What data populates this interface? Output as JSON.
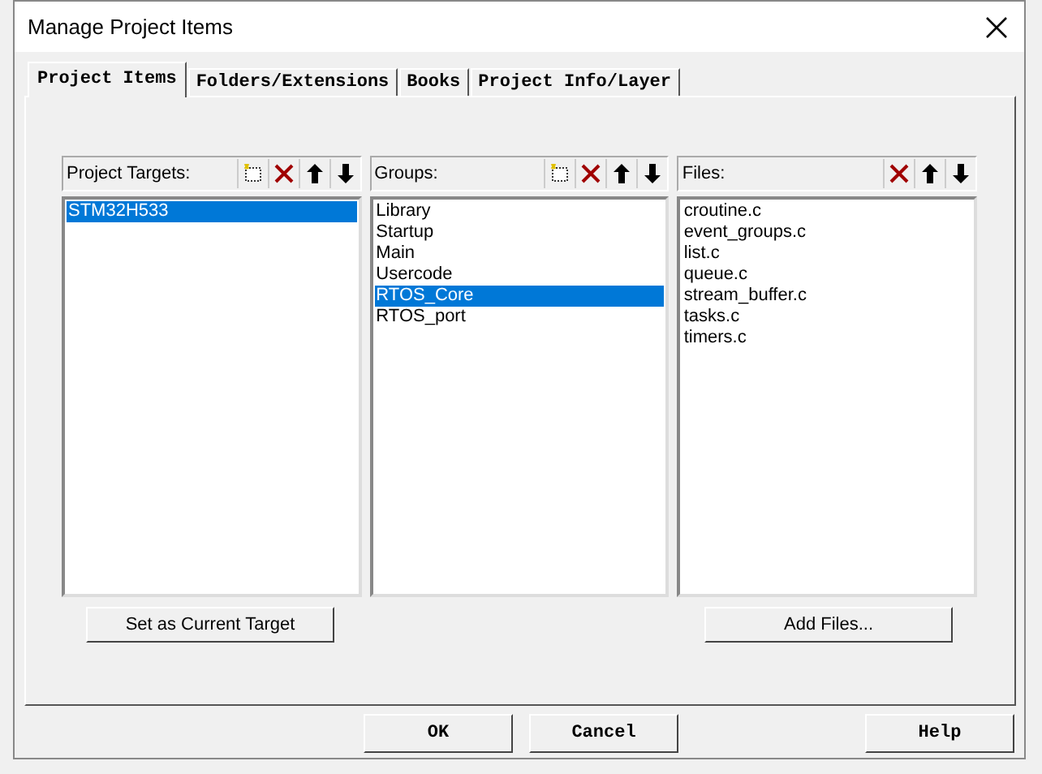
{
  "window": {
    "title": "Manage Project Items"
  },
  "tabs": [
    {
      "label": "Project Items",
      "selected": true
    },
    {
      "label": "Folders/Extensions",
      "selected": false
    },
    {
      "label": "Books",
      "selected": false
    },
    {
      "label": "Project Info/Layer",
      "selected": false
    }
  ],
  "panels": [
    {
      "label": "Project Targets:",
      "tools": [
        {
          "kind": "new"
        },
        {
          "kind": "delete"
        },
        {
          "kind": "up"
        },
        {
          "kind": "down"
        }
      ],
      "items": [
        {
          "label": "STM32H533",
          "selected": true
        }
      ],
      "button": "Set as Current Target"
    },
    {
      "label": "Groups:",
      "tools": [
        {
          "kind": "new"
        },
        {
          "kind": "delete"
        },
        {
          "kind": "up"
        },
        {
          "kind": "down"
        }
      ],
      "items": [
        {
          "label": "Library",
          "selected": false
        },
        {
          "label": "Startup",
          "selected": false
        },
        {
          "label": "Main",
          "selected": false
        },
        {
          "label": "Usercode",
          "selected": false
        },
        {
          "label": "RTOS_Core",
          "selected": true
        },
        {
          "label": "RTOS_port",
          "selected": false
        }
      ]
    },
    {
      "label": "Files:",
      "tools": [
        {
          "kind": "delete"
        },
        {
          "kind": "up"
        },
        {
          "kind": "down"
        }
      ],
      "items": [
        {
          "label": "croutine.c",
          "selected": false
        },
        {
          "label": "event_groups.c",
          "selected": false
        },
        {
          "label": "list.c",
          "selected": false
        },
        {
          "label": "queue.c",
          "selected": false
        },
        {
          "label": "stream_buffer.c",
          "selected": false
        },
        {
          "label": "tasks.c",
          "selected": false
        },
        {
          "label": "timers.c",
          "selected": false
        }
      ],
      "button": "Add Files..."
    }
  ],
  "buttons": [
    "OK",
    "Cancel",
    "Help"
  ]
}
